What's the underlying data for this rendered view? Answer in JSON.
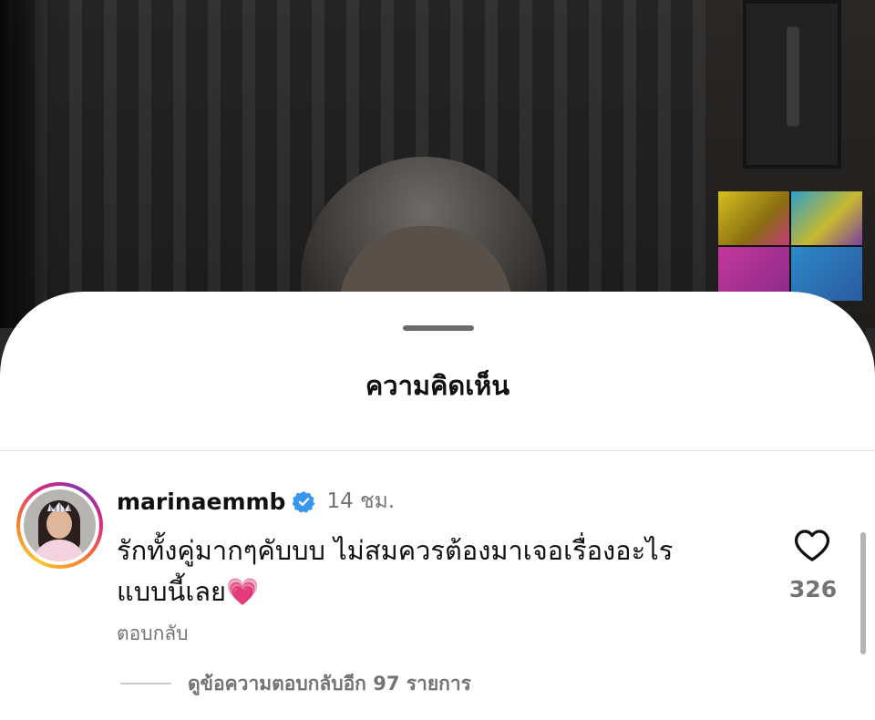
{
  "sheet": {
    "title": "ความคิดเห็น"
  },
  "comment": {
    "username": "marinaemmb",
    "verified": true,
    "time_ago": "14 ชม.",
    "text_line1": "รักทั้งคู่มากๆคับบบ ไม่สมควรต้องมาเจอเรื่องอะไร",
    "text_line2": "แบบนี้เลย💗",
    "reply_label": "ตอบกลับ",
    "like_count": "326",
    "view_replies_label": "ดูข้อความตอบกลับอีก 97 รายการ"
  },
  "icons": {
    "verified": "verified-badge-icon",
    "like": "heart-outline-icon",
    "avatar": "avatar-photo"
  },
  "colors": {
    "verified_blue": "#3797f0",
    "secondary_text": "#737373",
    "primary_text": "#111111"
  }
}
